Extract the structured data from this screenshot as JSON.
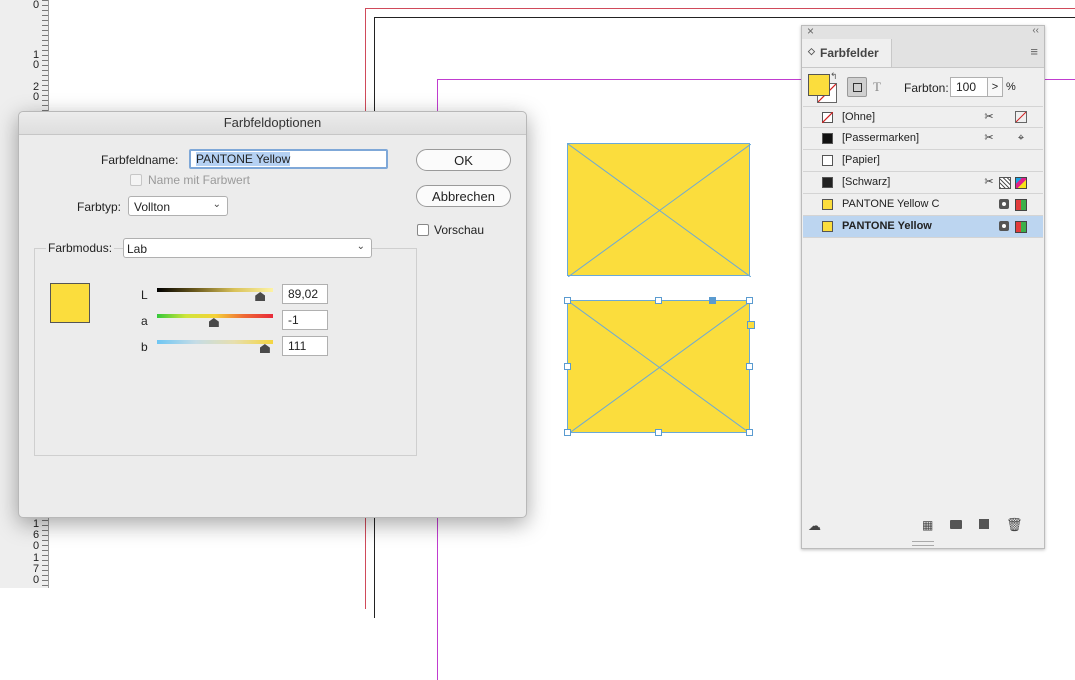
{
  "ruler": {
    "top_labels": [
      "0",
      "1",
      "0",
      "2",
      "0"
    ],
    "bottom_labels": [
      "1",
      "6",
      "0",
      "1",
      "7",
      "0"
    ]
  },
  "colors": {
    "swatch_yellow": "#fbdd3d",
    "selection_blue": "#bcd5f0",
    "frame_stroke": "#6aa9d8"
  },
  "dialog": {
    "title": "Farbfeldoptionen",
    "name_label": "Farbfeldname:",
    "name_value": "PANTONE Yellow",
    "name_with_value_label": "Name mit Farbwert",
    "name_with_value_checked": false,
    "type_label": "Farbtyp:",
    "type_value": "Vollton",
    "ok_label": "OK",
    "cancel_label": "Abbrechen",
    "preview_label": "Vorschau",
    "preview_checked": false,
    "mode_label": "Farbmodus:",
    "mode_value": "Lab",
    "sliders": [
      {
        "label": "L",
        "value": "89,02",
        "position": 0.89
      },
      {
        "label": "a",
        "value": "-1",
        "position": 0.49
      },
      {
        "label": "b",
        "value": "111",
        "position": 0.93
      }
    ]
  },
  "panel": {
    "close_icon": "×",
    "collapse_icon": "‹‹",
    "tab_arrow": "◇",
    "tab_label": "Farbfelder",
    "menu_icon": "≡",
    "tint_label": "Farbton:",
    "tint_value": "100",
    "tint_arrow": ">",
    "tint_unit": "%",
    "text_icon": "T",
    "swatches": [
      {
        "name": "[Ohne]",
        "chip": "none",
        "icons": [
          "scissors-icon",
          "none-icon"
        ],
        "selected": false
      },
      {
        "name": "[Passermarken]",
        "chip": "#111111",
        "icons": [
          "scissors-icon",
          "registration-icon"
        ],
        "selected": false
      },
      {
        "name": "[Papier]",
        "chip": "#ffffff",
        "icons": [],
        "selected": false
      },
      {
        "name": "[Schwarz]",
        "chip": "#222222",
        "icons": [
          "scissors-icon",
          "dotted-icon",
          "cmyk-icon"
        ],
        "selected": false
      },
      {
        "name": "PANTONE Yellow C",
        "chip": "#fbdd3d",
        "icons": [
          "spot-icon",
          "lab-icon"
        ],
        "selected": false
      },
      {
        "name": "PANTONE Yellow",
        "chip": "#fbdd3d",
        "icons": [
          "spot-icon",
          "lab-icon"
        ],
        "selected": true
      }
    ]
  }
}
